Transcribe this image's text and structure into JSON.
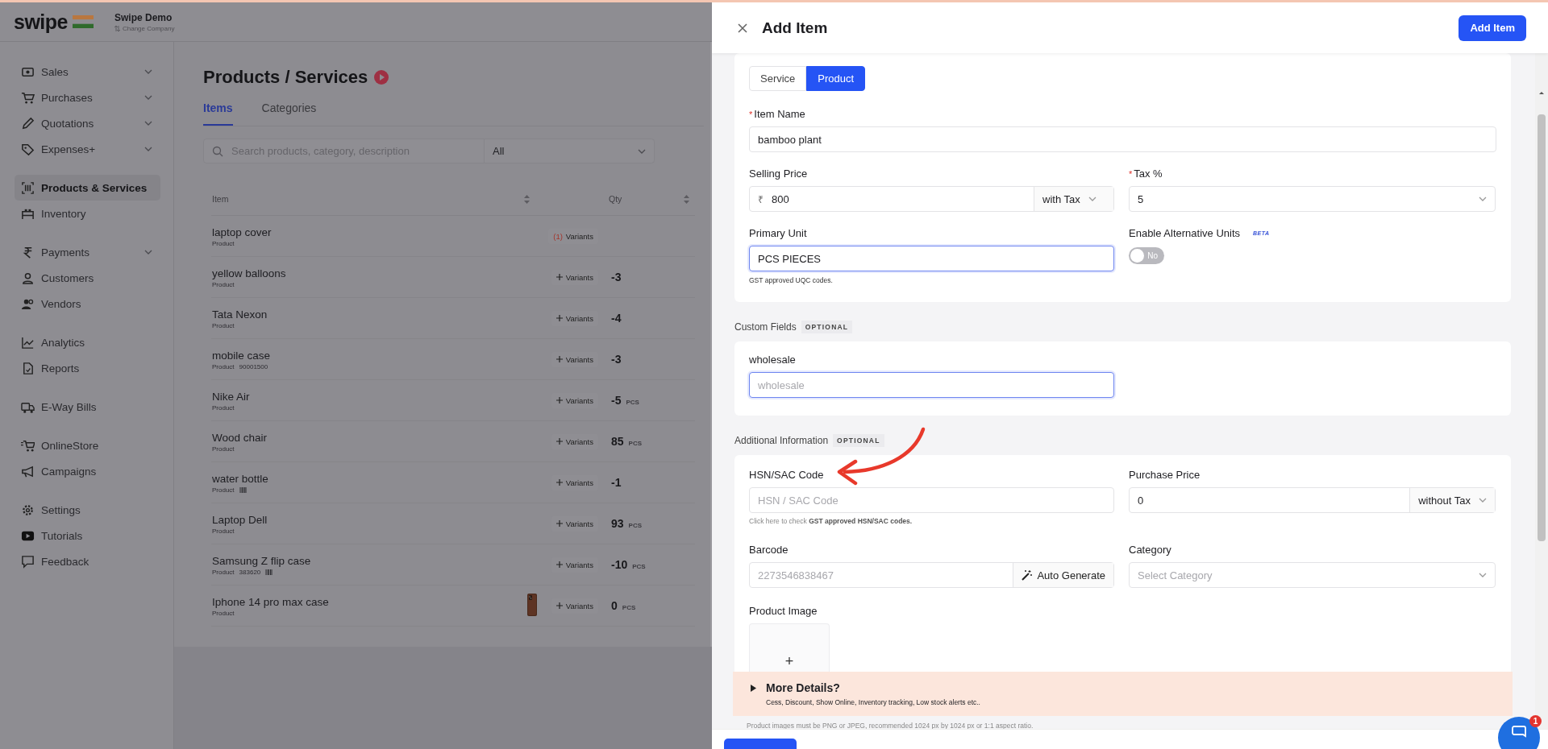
{
  "top_bar": {
    "logo": "swipe",
    "company": "Swipe Demo",
    "switch_label": "Change Company"
  },
  "sidebar": {
    "groups": [
      {
        "items": [
          {
            "label": "Sales",
            "selected": false,
            "expandable": true
          },
          {
            "label": "Purchases",
            "selected": false,
            "expandable": true
          },
          {
            "label": "Quotations",
            "selected": false,
            "expandable": true
          },
          {
            "label": "Expenses+",
            "selected": false,
            "expandable": true
          }
        ]
      },
      {
        "items": [
          {
            "label": "Products & Services",
            "selected": true,
            "expandable": false
          },
          {
            "label": "Inventory",
            "selected": false,
            "expandable": false
          }
        ]
      },
      {
        "items": [
          {
            "label": "Payments",
            "selected": false,
            "expandable": true
          },
          {
            "label": "Customers",
            "selected": false,
            "expandable": false
          },
          {
            "label": "Vendors",
            "selected": false,
            "expandable": false
          }
        ]
      },
      {
        "items": [
          {
            "label": "Analytics",
            "selected": false,
            "expandable": false
          },
          {
            "label": "Reports",
            "selected": false,
            "expandable": false
          }
        ]
      },
      {
        "items": [
          {
            "label": "E-Way Bills",
            "selected": false,
            "expandable": false
          }
        ]
      },
      {
        "items": [
          {
            "label": "OnlineStore",
            "selected": false,
            "expandable": false
          },
          {
            "label": "Campaigns",
            "selected": false,
            "expandable": false
          }
        ]
      },
      {
        "items": [
          {
            "label": "Settings",
            "selected": false,
            "expandable": false
          },
          {
            "label": "Tutorials",
            "selected": false,
            "expandable": false
          },
          {
            "label": "Feedback",
            "selected": false,
            "expandable": false
          }
        ]
      }
    ]
  },
  "products": {
    "title": "Products / Services",
    "tabs": [
      {
        "label": "Items",
        "selected": true
      },
      {
        "label": "Categories",
        "selected": false
      }
    ],
    "search": {
      "placeholder": "Search products, category, description"
    },
    "filter": {
      "value": "All"
    },
    "table": {
      "columns": [
        "Item",
        "Qty"
      ],
      "rows": [
        {
          "name": "laptop cover",
          "type": "Product",
          "variants": {
            "count": "(1)",
            "label": "Variants"
          }
        },
        {
          "name": "yellow balloons",
          "type": "Product",
          "variants": {
            "label": "Variants"
          },
          "qty": "-3"
        },
        {
          "name": "Tata Nexon",
          "type": "Product",
          "variants": {
            "label": "Variants"
          },
          "qty": "-4"
        },
        {
          "name": "mobile case",
          "type": "Product",
          "code": "90001500",
          "variants": {
            "label": "Variants"
          },
          "qty": "-3"
        },
        {
          "name": "Nike Air",
          "type": "Product",
          "variants": {
            "label": "Variants"
          },
          "qty": "-5",
          "unit": "PCS"
        },
        {
          "name": "Wood chair",
          "type": "Product",
          "variants": {
            "label": "Variants"
          },
          "qty": "85",
          "unit": "PCS"
        },
        {
          "name": "water bottle",
          "type": "Product",
          "barcode": true,
          "variants": {
            "label": "Variants"
          },
          "qty": "-1"
        },
        {
          "name": "Laptop Dell",
          "type": "Product",
          "variants": {
            "label": "Variants"
          },
          "qty": "93",
          "unit": "PCS"
        },
        {
          "name": "Samsung Z flip case",
          "type": "Product",
          "code": "383620",
          "barcode": true,
          "variants": {
            "label": "Variants"
          },
          "qty": "-10",
          "unit": "PCS"
        },
        {
          "name": "Iphone 14 pro max case",
          "type": "Product",
          "image": true,
          "variants": {
            "label": "Variants"
          },
          "qty": "0",
          "unit": "PCS"
        }
      ]
    }
  },
  "drawer": {
    "title": "Add Item",
    "submit": "Add Item",
    "item_type": [
      {
        "label": "Service",
        "selected": false
      },
      {
        "label": "Product",
        "selected": true
      }
    ],
    "item_name": {
      "label": "Item Name",
      "required_mark": "*",
      "value": "bamboo plant",
      "focused": false
    },
    "selling_price": {
      "label": "Selling Price",
      "prefix": "₹",
      "value": "800",
      "tax_mode": "with Tax"
    },
    "tax": {
      "label": "Tax %",
      "required_mark": "*",
      "value": "5"
    },
    "primary_unit": {
      "label": "Primary Unit",
      "value": "PCS PIECES",
      "focused": true,
      "help": "GST approved UQC codes."
    },
    "alt_units": {
      "label": "Enable Alternative Units",
      "badge": "BETA",
      "on": false,
      "state_text": "No"
    },
    "custom_fields": {
      "heading": "Custom Fields",
      "badge": "OPTIONAL",
      "fields": [
        {
          "label": "wholesale",
          "placeholder": "wholesale",
          "focused": true
        }
      ]
    },
    "additional": {
      "heading": "Additional Information",
      "badge": "OPTIONAL",
      "hsn": {
        "label": "HSN/SAC Code",
        "placeholder": "HSN / SAC Code",
        "help": "Click here to check **GST approved HSN/SAC codes.**"
      },
      "purchase_price": {
        "label": "Purchase Price",
        "value": "0",
        "tax_mode": "without Tax"
      },
      "barcode": {
        "label": "Barcode",
        "placeholder": "2273546838467",
        "button": "Auto Generate"
      },
      "category": {
        "label": "Category",
        "placeholder": "Select Category"
      },
      "image": {
        "label": "Product Image",
        "button": "+"
      }
    },
    "more_details": {
      "title": "More Details?",
      "subtitle": "Cess, Discount, Show Online, Inventory tracking, Low stock alerts etc..",
      "expanded": false
    },
    "image_hint": "Product images must be PNG or JPEG, recommended 1024 px by 1024 px or 1:1 aspect ratio."
  },
  "chat": {
    "badge": "1"
  }
}
